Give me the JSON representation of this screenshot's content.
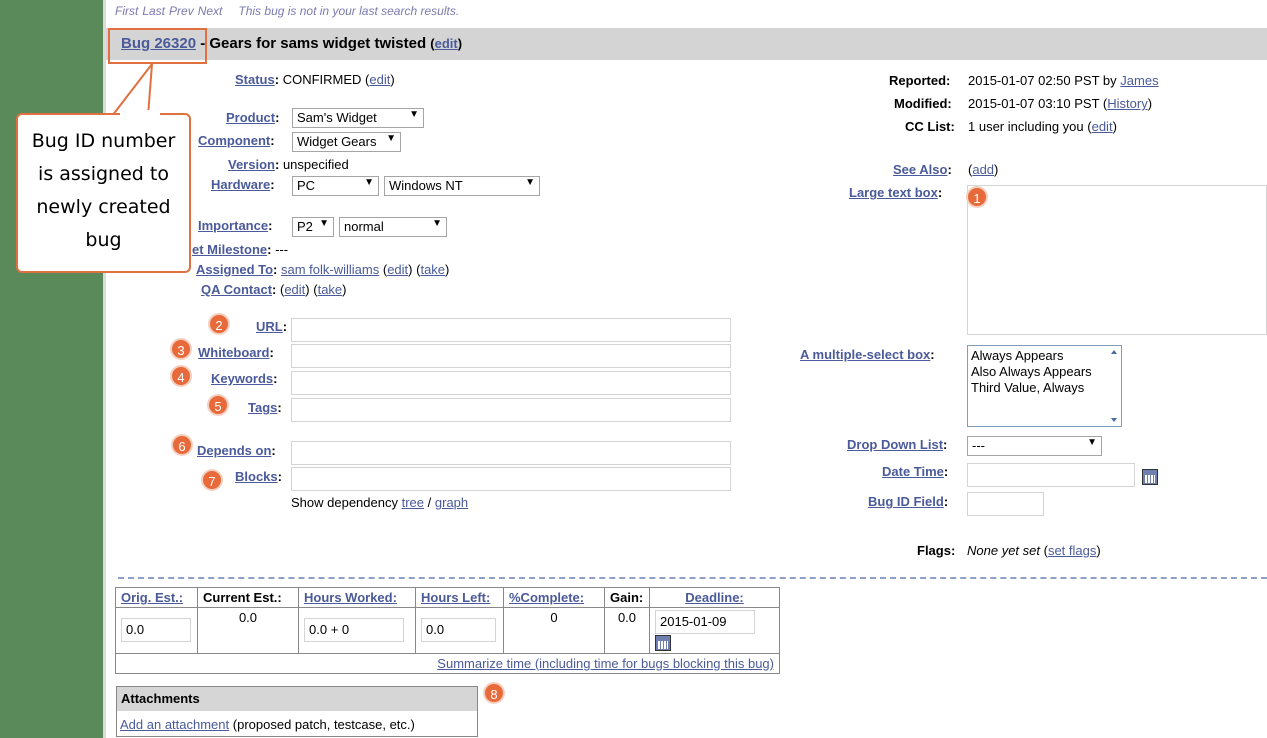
{
  "nav": {
    "first": "First",
    "last": "Last",
    "prev": "Prev",
    "next": "Next",
    "note": "This bug is not in your last search results."
  },
  "title": {
    "bug_link": "Bug 26320",
    "separator": " - ",
    "summary": "Gears for sams widget twisted",
    "edit": "edit"
  },
  "callout": {
    "line1": "Bug ID number",
    "line2": "is assigned to",
    "line3": "newly created",
    "line4": "bug"
  },
  "left": {
    "status_label": "Status",
    "status_value": "CONFIRMED",
    "status_edit": "edit",
    "product_label": "Product",
    "product_value": "Sam's Widget",
    "component_label": "Component",
    "component_value": "Widget Gears",
    "version_label": "Version",
    "version_value": "unspecified",
    "hardware_label": "Hardware",
    "hardware_value": "PC",
    "os_value": "Windows NT",
    "importance_label": "Importance",
    "priority_value": "P2",
    "severity_value": "normal",
    "milestone_label": "et Milestone",
    "milestone_value": "---",
    "assigned_label": "Assigned To",
    "assigned_value": "sam folk-williams",
    "assigned_edit": "edit",
    "assigned_take": "take",
    "qa_label": "QA Contact",
    "qa_edit": "edit",
    "qa_take": "take",
    "url_label": "URL",
    "whiteboard_label": "Whiteboard",
    "keywords_label": "Keywords",
    "tags_label": "Tags",
    "depends_label": "Depends on",
    "blocks_label": "Blocks",
    "dep_text": "Show dependency",
    "dep_tree": "tree",
    "dep_sep": "/",
    "dep_graph": "graph"
  },
  "right": {
    "reported_label": "Reported:",
    "reported_value": "2015-01-07 02:50 PST by",
    "reported_by": "James",
    "modified_label": "Modified:",
    "modified_value": "2015-01-07 03:10 PST",
    "history": "History",
    "cc_label": "CC List:",
    "cc_value": "1 user including you",
    "cc_edit": "edit",
    "see_also_label": "See Also",
    "see_also_add": "add",
    "large_text_label": "Large text box",
    "multi_label": "A multiple-select box",
    "multi_options": [
      "Always Appears",
      "Also Always Appears",
      "Third Value, Always"
    ],
    "dropdown_label": "Drop Down List",
    "dropdown_value": "---",
    "datetime_label": "Date Time",
    "bugid_label": "Bug ID Field",
    "flags_label": "Flags:",
    "flags_value": "None yet set",
    "flags_set": "set flags"
  },
  "badges": [
    "1",
    "2",
    "3",
    "4",
    "5",
    "6",
    "7",
    "8"
  ],
  "time": {
    "headers": [
      "Orig. Est.:",
      "Current Est.:",
      "Hours Worked:",
      "Hours Left:",
      "%Complete:",
      "Gain:",
      "Deadline:"
    ],
    "orig": "0.0",
    "current": "0.0",
    "worked": "0.0",
    "plus": "+",
    "add": "0",
    "left": "0.0",
    "complete": "0",
    "gain": "0.0",
    "deadline": "2015-01-09",
    "summarize": "Summarize time (including time for bugs blocking this bug)"
  },
  "attachments": {
    "title": "Attachments",
    "add": "Add an attachment",
    "note": "(proposed patch, testcase, etc.)"
  },
  "colors": {
    "accent": "#e86a3a",
    "link": "#4a5a9a",
    "header_bg": "#d4d4d4"
  }
}
